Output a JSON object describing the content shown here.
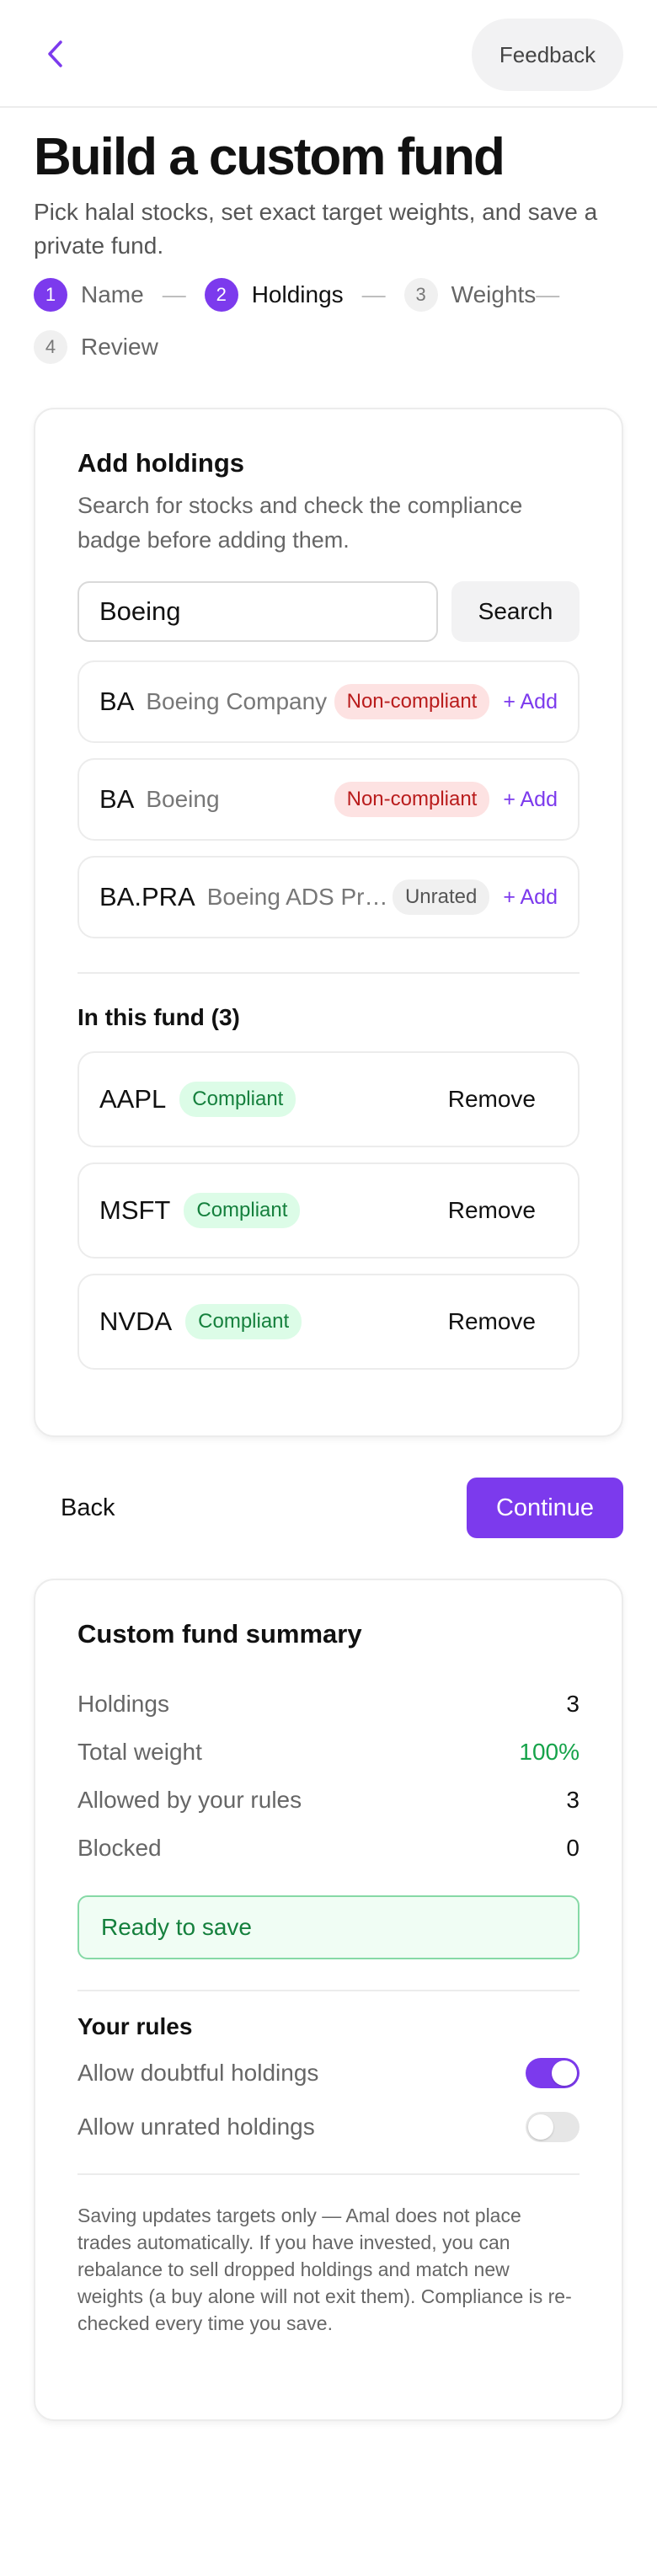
{
  "header": {
    "back_icon": "chevron-left-icon",
    "feedback_label": "Feedback"
  },
  "page": {
    "title": "Build a custom fund",
    "subtitle": "Pick halal stocks, set exact target weights, and save a private fund."
  },
  "stepper": {
    "steps": [
      {
        "number": "1",
        "label": "Name",
        "state": "done"
      },
      {
        "number": "2",
        "label": "Holdings",
        "state": "current"
      },
      {
        "number": "3",
        "label": "Weights",
        "state": "upcoming"
      },
      {
        "number": "4",
        "label": "Review",
        "state": "upcoming"
      }
    ],
    "separator": "—"
  },
  "add_holdings": {
    "title": "Add holdings",
    "description": "Search for stocks and check the compliance badge before adding them.",
    "search_value": "Boeing",
    "search_button": "Search",
    "results": [
      {
        "ticker": "BA",
        "company": "Boeing Company",
        "status": "Non-compliant",
        "action": "+ Add"
      },
      {
        "ticker": "BA",
        "company": "Boeing",
        "status": "Non-compliant",
        "action": "+ Add"
      },
      {
        "ticker": "BA.PRA",
        "company": "Boeing ADS Preferred",
        "status": "Unrated",
        "action": "+ Add"
      }
    ],
    "fund_heading": "In this fund (3)",
    "fund_holdings": [
      {
        "ticker": "AAPL",
        "status": "Compliant",
        "action": "Remove"
      },
      {
        "ticker": "MSFT",
        "status": "Compliant",
        "action": "Remove"
      },
      {
        "ticker": "NVDA",
        "status": "Compliant",
        "action": "Remove"
      }
    ]
  },
  "nav": {
    "back_label": "Back",
    "continue_label": "Continue"
  },
  "summary": {
    "title": "Custom fund summary",
    "stats": [
      {
        "label": "Holdings",
        "value": "3"
      },
      {
        "label": "Total weight",
        "value": "100%"
      },
      {
        "label": "Allowed by your rules",
        "value": "3"
      },
      {
        "label": "Blocked",
        "value": "0"
      }
    ],
    "ready_text": "Ready to save",
    "rules_heading": "Your rules",
    "rules": [
      {
        "label": "Allow doubtful holdings",
        "enabled": true
      },
      {
        "label": "Allow unrated holdings",
        "enabled": false
      }
    ],
    "disclaimer": "Saving updates targets only — Amal does not place trades automatically. If you have invested, you can rebalance to sell dropped holdings and match new weights (a buy alone will not exit them). Compliance is re-checked every time you save."
  },
  "colors": {
    "accent": "#7c3aed",
    "compliant": "#15803d",
    "noncompliant": "#b91c1c",
    "positive": "#16a34a"
  }
}
